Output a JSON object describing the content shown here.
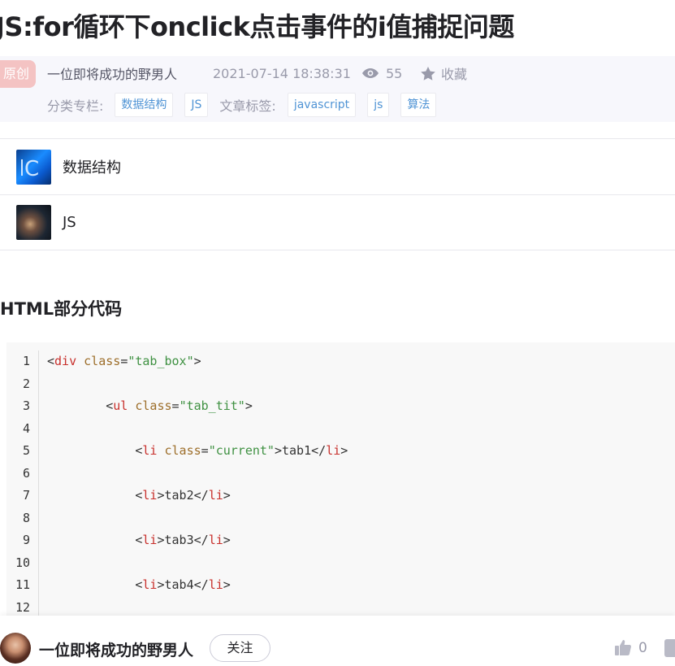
{
  "article": {
    "title": "JS:for循环下onclick点击事件的i值捕捉问题",
    "badge": "原创",
    "author": "一位即将成功的野男人",
    "date": "2021-07-14 18:38:31",
    "views": "55",
    "favorite_label": "收藏",
    "category_label": "分类专栏:",
    "categories": [
      "数据结构",
      "JS"
    ],
    "tags_label": "文章标签:",
    "tags": [
      "javascript",
      "js",
      "算法"
    ]
  },
  "columns": [
    {
      "name": "数据结构",
      "icon": "column-thumbnail"
    },
    {
      "name": "JS",
      "icon": "column-thumbnail"
    }
  ],
  "section": {
    "heading": "HTML部分代码"
  },
  "code": {
    "line_numbers": [
      "1",
      "2",
      "3",
      "4",
      "5",
      "6",
      "7",
      "8",
      "9",
      "10",
      "11",
      "12"
    ],
    "lines": [
      "<div class=\"tab_box\">",
      "",
      "        <ul class=\"tab_tit\">",
      "",
      "            <li class=\"current\">tab1</li>",
      "",
      "            <li>tab2</li>",
      "",
      "            <li>tab3</li>",
      "",
      "            <li>tab4</li>",
      ""
    ]
  },
  "footer": {
    "author": "一位即将成功的野男人",
    "follow_label": "关注",
    "likes": "0"
  },
  "colors": {
    "code_tag": "#c8302c",
    "code_attr": "#9d6e2a",
    "code_string": "#3f9142",
    "tag_text": "#5094d5"
  }
}
